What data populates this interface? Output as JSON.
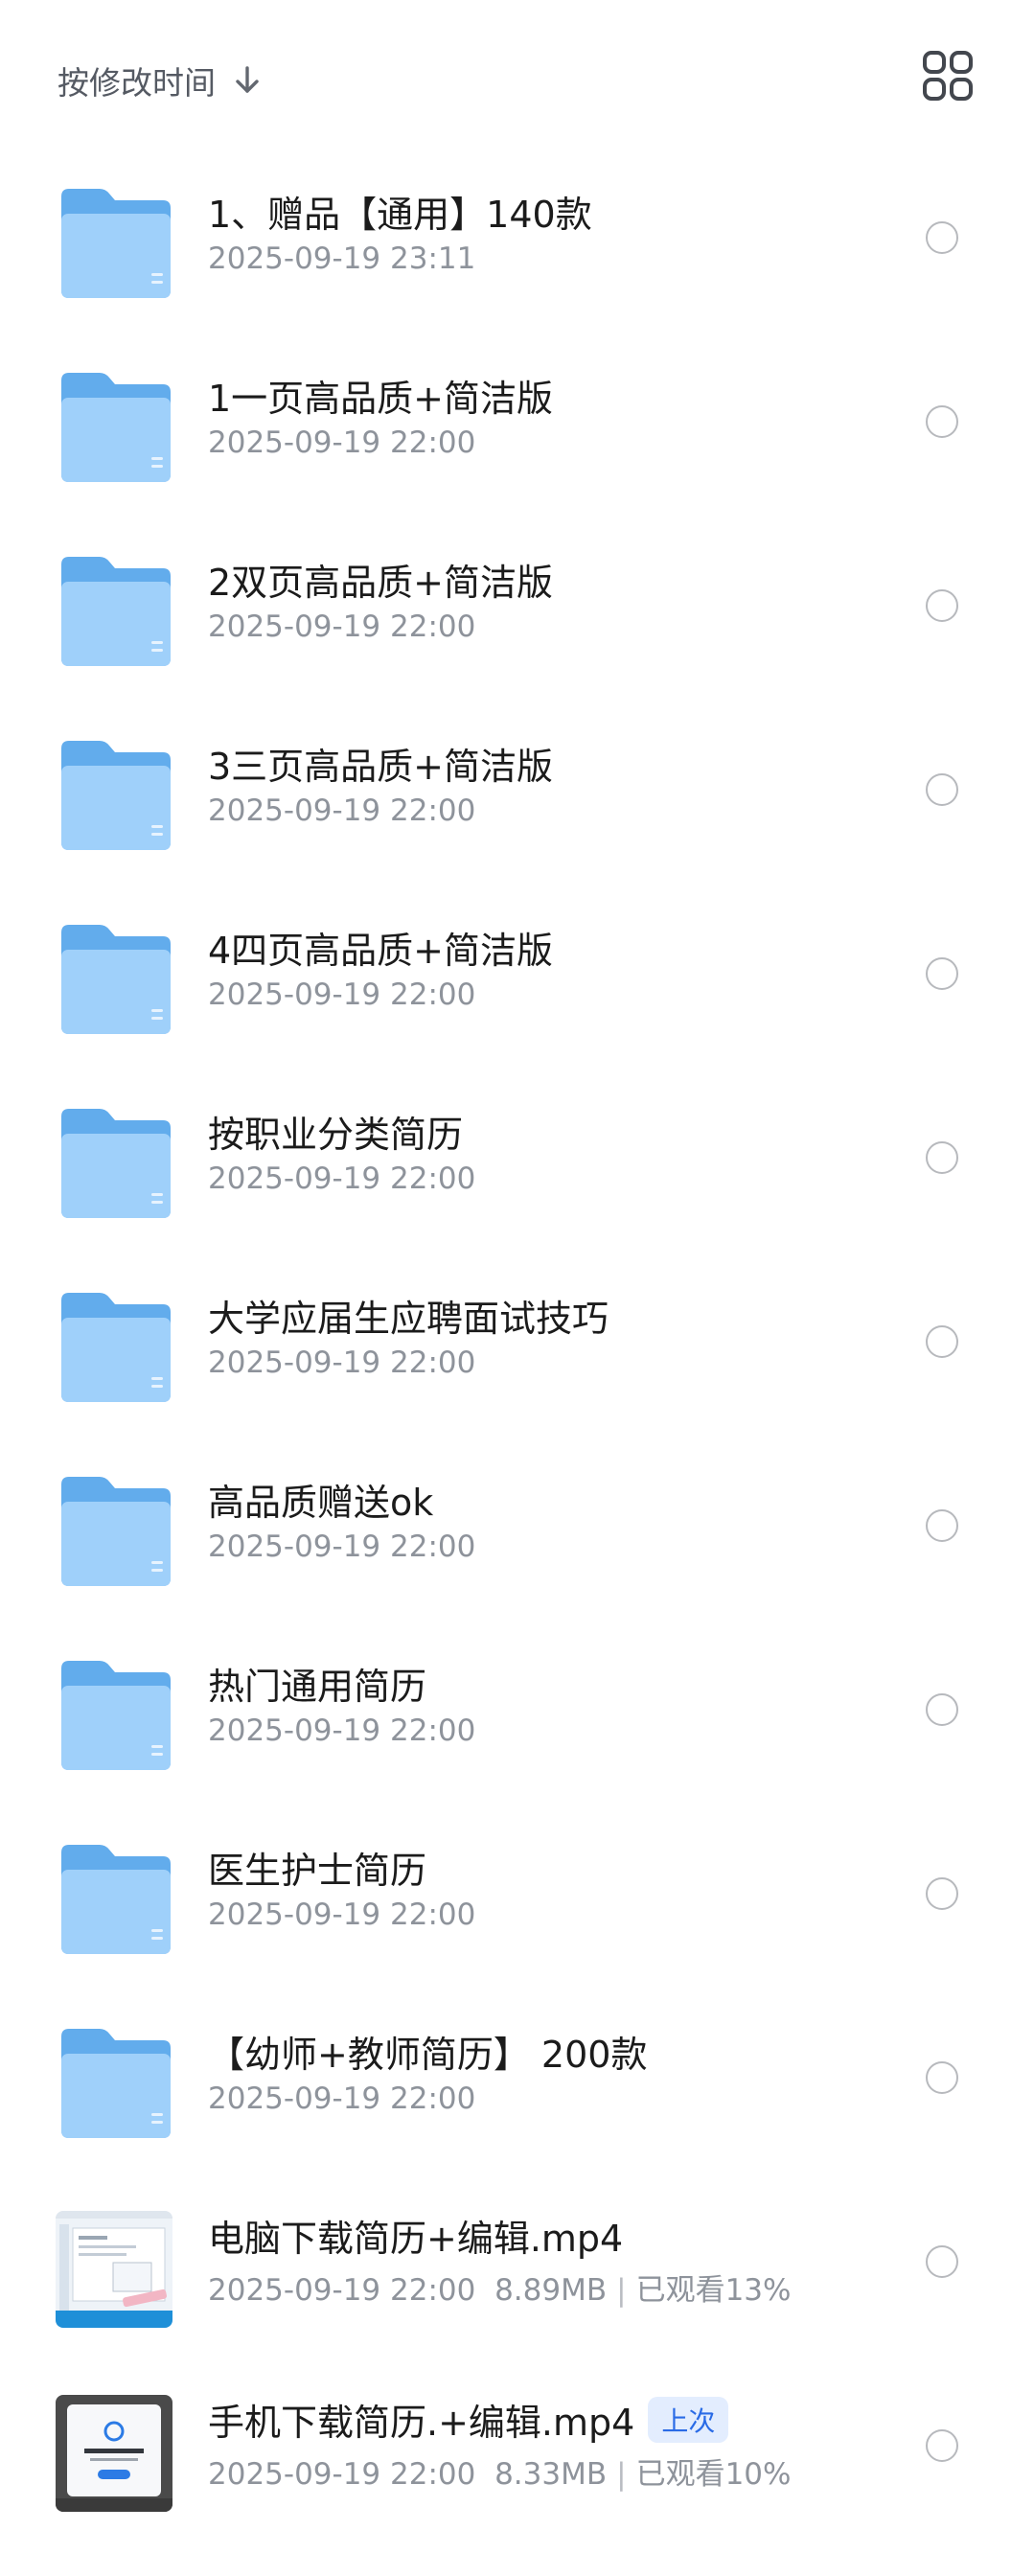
{
  "toolbar": {
    "sort_label": "按修改时间",
    "sort_icon": "arrow-down-icon",
    "view_icon": "grid-view-icon"
  },
  "colors": {
    "folder_back": "#62acec",
    "folder_front": "#9fd0fa",
    "badge_bg": "#e3edfe",
    "badge_text": "#2a6be6"
  },
  "files": [
    {
      "type": "folder",
      "name": "1、赠品【通用】140款",
      "modified": "2025-09-19 23:11"
    },
    {
      "type": "folder",
      "name": "1一页高品质+简洁版",
      "modified": "2025-09-19 22:00"
    },
    {
      "type": "folder",
      "name": "2双页高品质+简洁版",
      "modified": "2025-09-19 22:00"
    },
    {
      "type": "folder",
      "name": "3三页高品质+简洁版",
      "modified": "2025-09-19 22:00"
    },
    {
      "type": "folder",
      "name": "4四页高品质+简洁版",
      "modified": "2025-09-19 22:00"
    },
    {
      "type": "folder",
      "name": "按职业分类简历",
      "modified": "2025-09-19 22:00"
    },
    {
      "type": "folder",
      "name": "大学应届生应聘面试技巧",
      "modified": "2025-09-19 22:00"
    },
    {
      "type": "folder",
      "name": "高品质赠送ok",
      "modified": "2025-09-19 22:00"
    },
    {
      "type": "folder",
      "name": "热门通用简历",
      "modified": "2025-09-19 22:00"
    },
    {
      "type": "folder",
      "name": "医生护士简历",
      "modified": "2025-09-19 22:00"
    },
    {
      "type": "folder",
      "name": "【幼师+教师简历】 200款",
      "modified": "2025-09-19 22:00"
    },
    {
      "type": "video",
      "name": "电脑下载简历+编辑.mp4",
      "modified": "2025-09-19 22:00",
      "size": "8.89MB",
      "watched": "已观看13%"
    },
    {
      "type": "video",
      "name": "手机下载简历.+编辑.mp4",
      "modified": "2025-09-19 22:00",
      "size": "8.33MB",
      "watched": "已观看10%",
      "badge": "上次"
    }
  ]
}
